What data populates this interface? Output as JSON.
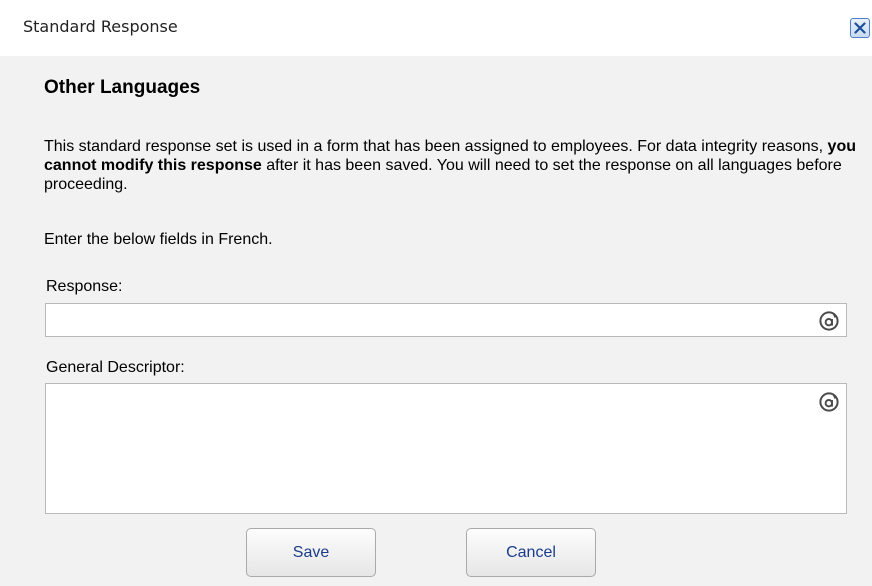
{
  "dialog": {
    "title": "Standard Response",
    "close_icon": "close-icon"
  },
  "content": {
    "heading": "Other Languages",
    "intro": {
      "part1": "This standard response set is used in a form that has been assigned to employees. For data integrity reasons, ",
      "bold": "you cannot modify this response",
      "part2": " after it has been saved. You will need to set the response on all languages before proceeding."
    },
    "instruction": "Enter the below fields in French."
  },
  "form": {
    "response_label": "Response:",
    "response_value": "",
    "descriptor_label": "General Descriptor:",
    "descriptor_value": "",
    "translate_icon": "translate-icon"
  },
  "buttons": {
    "save": "Save",
    "cancel": "Cancel"
  },
  "colors": {
    "accent": "#4d7fc4",
    "button_text": "#1a3c8c",
    "dialog_background": "#f2f2f2"
  }
}
